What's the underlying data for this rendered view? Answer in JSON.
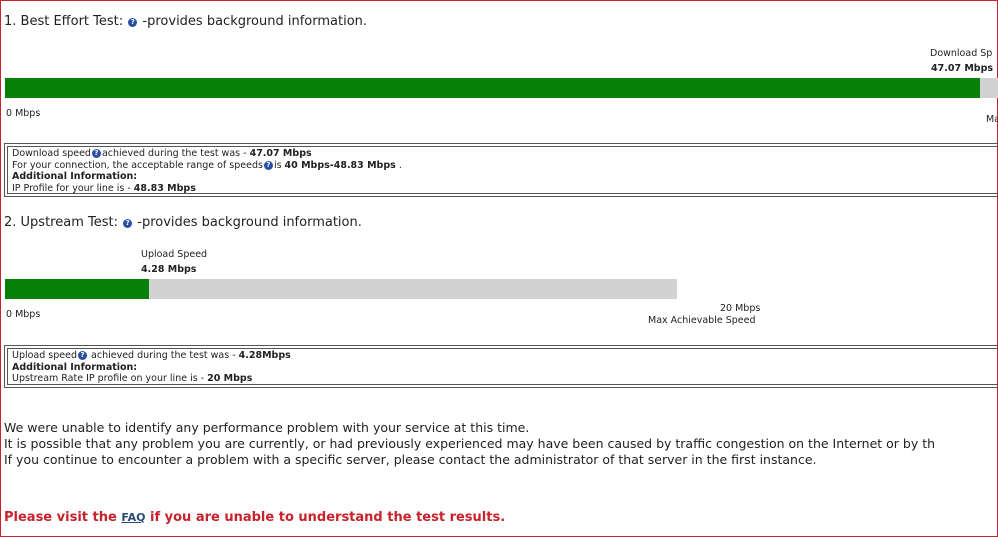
{
  "download": {
    "heading_num": "1. Best Effort Test:",
    "heading_suffix": "-provides background information.",
    "speed_label": "Download Sp",
    "speed_value": "47.07 Mbps",
    "min_label": "0 Mbps",
    "max_label_partial": "Ma",
    "fill_fraction": 0.975,
    "info": {
      "line1_pre": "Download speed",
      "line1_mid": "achieved during the test was - ",
      "line1_val": "47.07 Mbps",
      "line2_pre": "For your connection, the acceptable range of speeds",
      "line2_mid": "is ",
      "line2_val": "40 Mbps-48.83 Mbps",
      "line2_post": " .",
      "line3": "Additional Information:",
      "line4_pre": "IP Profile for your line is - ",
      "line4_val": "48.83 Mbps"
    }
  },
  "upload": {
    "heading_num": "2. Upstream Test:",
    "heading_suffix": "-provides background information.",
    "speed_label": "Upload Speed",
    "speed_value": "4.28 Mbps",
    "min_label": "0 Mbps",
    "max_value": "20 Mbps",
    "max_label": "Max Achievable Speed",
    "fill_fraction": 0.214,
    "info": {
      "line1_pre": "Upload speed",
      "line1_mid": " achieved during the test was - ",
      "line1_val": "4.28Mbps",
      "line2": "Additional Information:",
      "line3_pre": "Upstream Rate IP profile on your line is - ",
      "line3_val": "20 Mbps"
    }
  },
  "summary": {
    "line1": "We were unable to identify any performance problem with your service at this time.",
    "line2": "It is possible that any problem you are currently, or had previously experienced may have been caused by traffic congestion on the Internet or by th",
    "line3": "If you continue to encounter a problem with a specific server, please contact the administrator of that server in the first instance."
  },
  "footer": {
    "pre": "Please visit the ",
    "link": "FAQ",
    "post": " if you are unable to understand the test results."
  },
  "icons": {
    "help": "?"
  },
  "colors": {
    "bar_fill": "#078007",
    "bar_track": "#d2d2d2",
    "frame": "#c8232c",
    "footer_text": "#c8232c"
  }
}
